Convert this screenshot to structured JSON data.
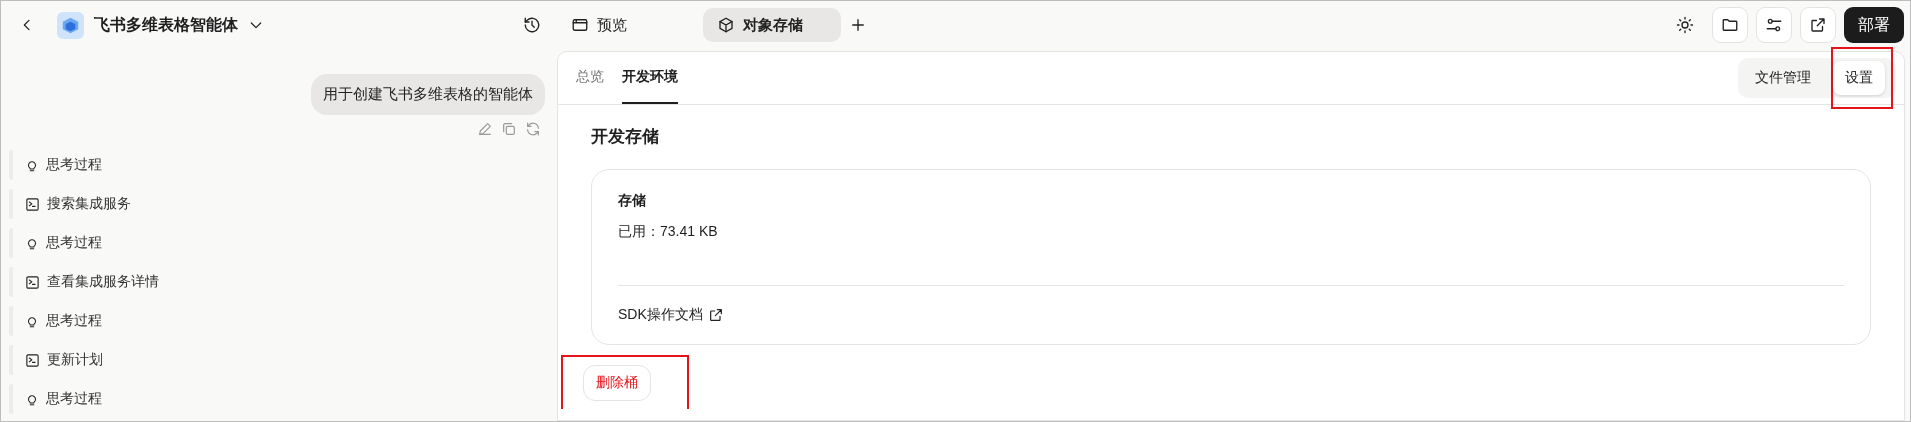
{
  "header": {
    "title": "飞书多维表格智能体"
  },
  "chat": {
    "message": "用于创建飞书多维表格的智能体",
    "steps": [
      {
        "kind": "thought",
        "label": "思考过程"
      },
      {
        "kind": "tool",
        "label": "搜索集成服务"
      },
      {
        "kind": "thought",
        "label": "思考过程"
      },
      {
        "kind": "tool",
        "label": "查看集成服务详情"
      },
      {
        "kind": "thought",
        "label": "思考过程"
      },
      {
        "kind": "tool",
        "label": "更新计划"
      },
      {
        "kind": "thought",
        "label": "思考过程"
      }
    ]
  },
  "tabs": [
    {
      "kind": "preview",
      "label": "预览",
      "selected": false
    },
    {
      "kind": "storage",
      "label": "对象存储",
      "selected": true
    }
  ],
  "deploy_button": "部署",
  "subtabs": [
    {
      "label": "总览",
      "selected": false
    },
    {
      "label": "开发环境",
      "selected": true
    }
  ],
  "segmented": [
    {
      "label": "文件管理",
      "selected": false,
      "highlighted": false
    },
    {
      "label": "设置",
      "selected": true,
      "highlighted": true
    }
  ],
  "section_title": "开发存储",
  "storage_card": {
    "title": "存储",
    "usage": "已用：73.41 KB",
    "docs_link": "SDK操作文档"
  },
  "delete_button": {
    "label": "删除桶",
    "highlighted": true
  }
}
